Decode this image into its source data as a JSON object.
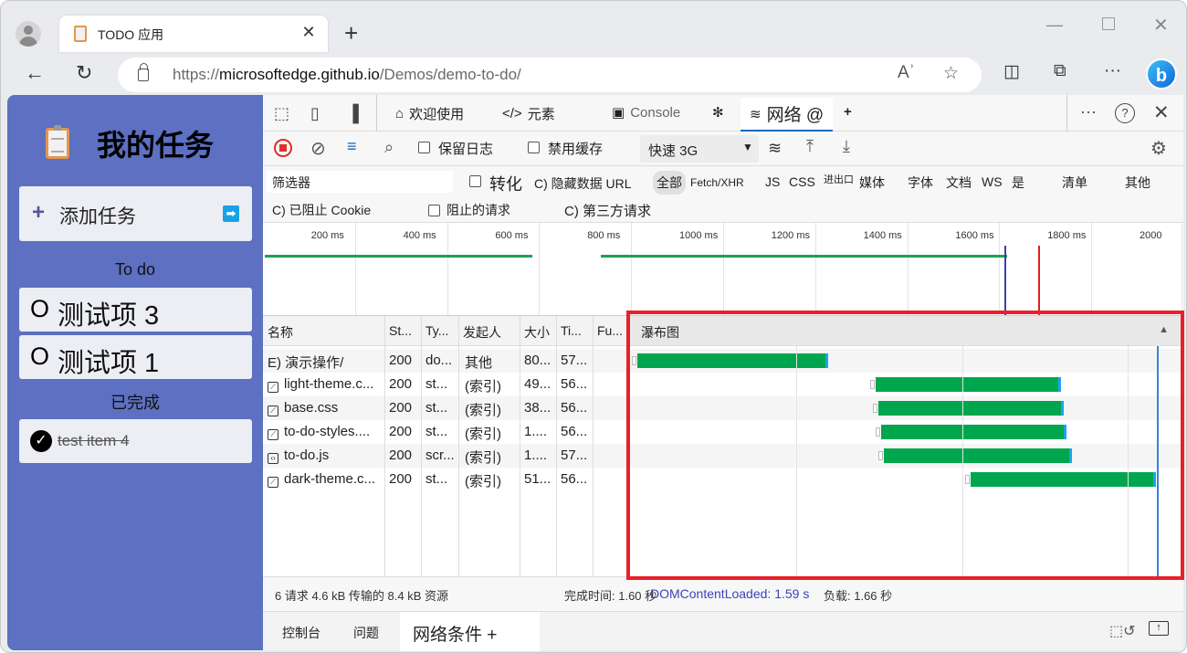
{
  "browser": {
    "tab_title": "TODO 应用",
    "url_host_prefix": "https://",
    "url_host": "microsoftedge.github.io",
    "url_path": "/Demos/demo-to-do/",
    "icons": [
      "profile-icon",
      "tab-favicon-clipboard",
      "close-tab-icon",
      "new-tab-icon",
      "minimize-icon",
      "maximize-icon",
      "close-window-icon",
      "back-icon",
      "refresh-icon",
      "lock-icon",
      "read-aloud-icon",
      "favorite-star-icon",
      "split-screen-icon",
      "collections-icon",
      "more-icon",
      "bing-copilot-icon"
    ]
  },
  "app": {
    "title": "我的任务",
    "add_task_label": "添加任务",
    "todo_heading": "To do",
    "todo_items": [
      {
        "marker": "O",
        "label": "测试项 3"
      },
      {
        "marker": "O",
        "label": "测试项 1"
      }
    ],
    "done_heading": "已完成",
    "done_items": [
      {
        "label": "test item 4"
      }
    ]
  },
  "devtools": {
    "tabs": [
      {
        "label": "欢迎使用",
        "icon": "home-icon"
      },
      {
        "label": "元素",
        "icon": "code-icon"
      },
      {
        "label": "Console",
        "icon": "console-icon"
      },
      {
        "label": "",
        "icon": "bug-icon"
      },
      {
        "label": "网络 @",
        "icon": "wifi-icon",
        "active": true
      }
    ],
    "add_tab": "+",
    "toolbar": {
      "preserve_log": "保留日志",
      "disable_cache": "禁用缓存",
      "throttle": "快速 3G"
    },
    "filter": {
      "placeholder": "筛选器",
      "invert": "转化",
      "hide_data_urls": "C) 隐藏数据 URL",
      "types": [
        "全部",
        "Fetch/XHR",
        "JS",
        "CSS",
        "进出口",
        "媒体",
        "字体",
        "文档",
        "WS",
        "是",
        "清单",
        "其他"
      ],
      "blocked_cookies": "C) 已阻止 Cookie",
      "blocked_requests": "阻止的请求",
      "third_party": "C) 第三方请求"
    },
    "overview_ticks": [
      "200 ms",
      "400 ms",
      "600 ms",
      "800 ms",
      "1000 ms",
      "1200 ms",
      "1400 ms",
      "1600 ms",
      "1800 ms",
      "2000"
    ],
    "columns": [
      "名称",
      "St...",
      "Ty...",
      "发起人",
      "大小",
      "Ti...",
      "Fu...",
      "瀑布图"
    ],
    "rows": [
      {
        "name": "E) 演示操作/",
        "icon": "document-icon",
        "status": "200",
        "type": "do...",
        "initiator": "其他",
        "size": "80...",
        "time": "57...",
        "wf_start": 0.0,
        "wf_end": 0.36
      },
      {
        "name": "light-theme.c...",
        "icon": "stylesheet-icon",
        "status": "200",
        "type": "st...",
        "initiator": "(索引)",
        "size": "49...",
        "time": "56...",
        "wf_start": 0.45,
        "wf_end": 0.8
      },
      {
        "name": "base.css",
        "icon": "stylesheet-icon",
        "status": "200",
        "type": "st...",
        "initiator": "(索引)",
        "size": "38...",
        "time": "56...",
        "wf_start": 0.455,
        "wf_end": 0.805
      },
      {
        "name": "to-do-styles....",
        "icon": "stylesheet-icon",
        "status": "200",
        "type": "st...",
        "initiator": "(索引)",
        "size": "1....",
        "time": "56...",
        "wf_start": 0.46,
        "wf_end": 0.81
      },
      {
        "name": "to-do.js",
        "icon": "script-icon",
        "status": "200",
        "type": "scr...",
        "initiator": "(索引)",
        "size": "1....",
        "time": "57...",
        "wf_start": 0.465,
        "wf_end": 0.82
      },
      {
        "name": "dark-theme.c...",
        "icon": "stylesheet-icon",
        "status": "200",
        "type": "st...",
        "initiator": "(索引)",
        "size": "51...",
        "time": "56...",
        "wf_start": 0.63,
        "wf_end": 0.98
      }
    ],
    "status_bar": {
      "summary": "6 请求 4.6 kB 传输的 8.4 kB 资源",
      "finish": "完成时间: 1.60 秒",
      "dcl": "DOMContentLoaded: 1.59 s",
      "load": "负载: 1.66 秒"
    },
    "drawer_tabs": [
      "控制台",
      "问题",
      "网络条件 +"
    ]
  }
}
